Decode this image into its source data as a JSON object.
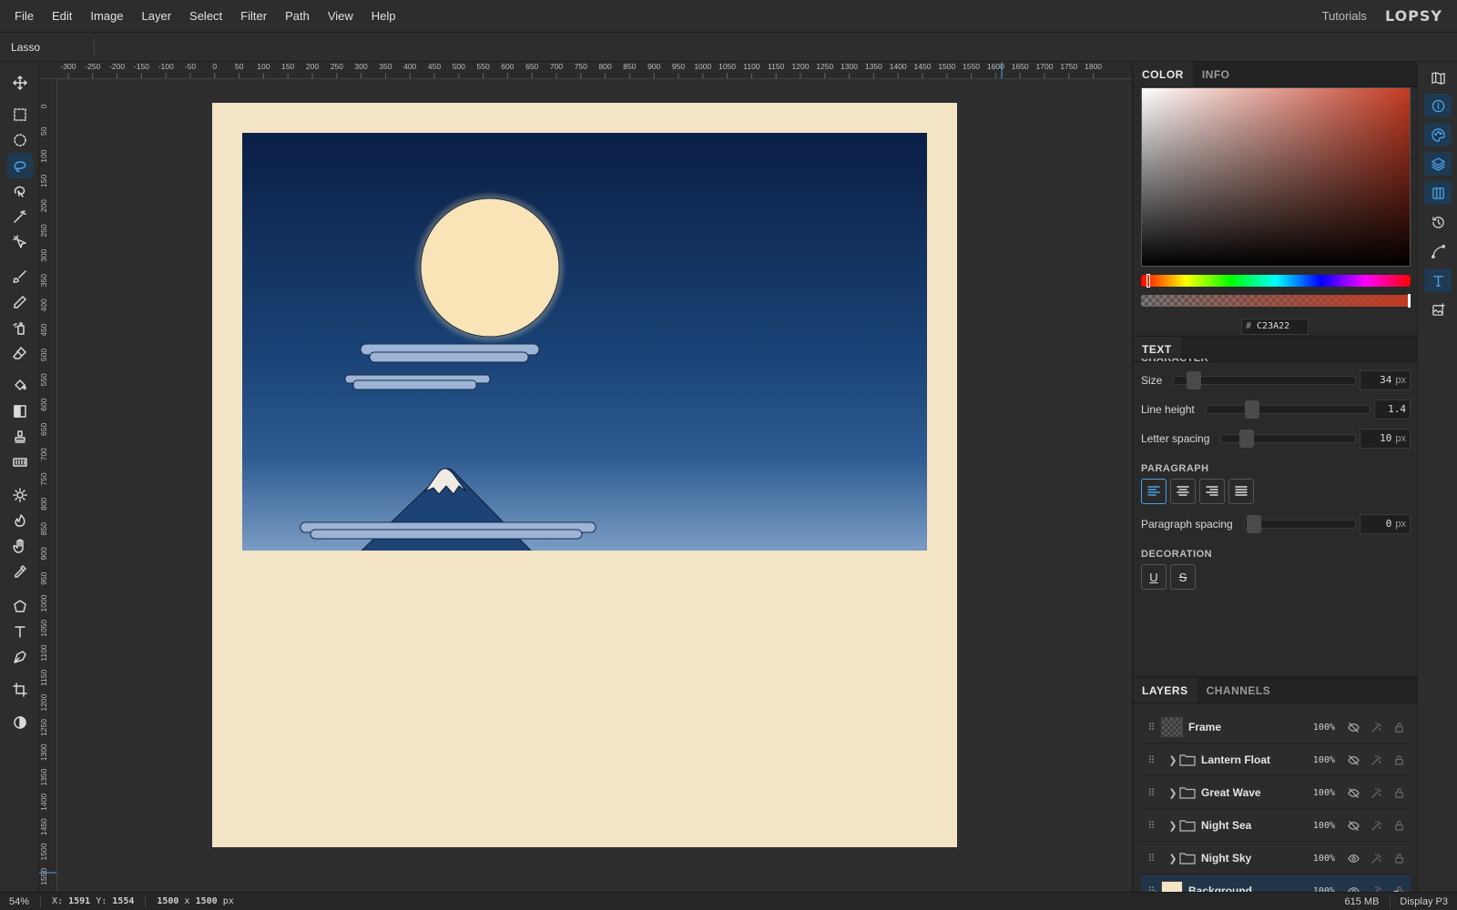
{
  "menu": [
    "File",
    "Edit",
    "Image",
    "Layer",
    "Select",
    "Filter",
    "Path",
    "View",
    "Help"
  ],
  "header": {
    "tutorials": "Tutorials",
    "logo": "LOPSY"
  },
  "options_bar": {
    "tool_name": "Lasso"
  },
  "tools": [
    "move-icon",
    "marquee-icon",
    "ellipse-select-icon",
    "lasso-icon",
    "object-select-icon",
    "magic-wand-icon",
    "quick-select-icon",
    "brush-icon",
    "pencil-icon",
    "spray-icon",
    "eraser-icon",
    "bucket-icon",
    "gradient-icon",
    "stamp-icon",
    "pattern-icon",
    "dodge-icon",
    "burn-icon",
    "hand-icon",
    "eyedropper-icon",
    "polygon-icon",
    "text-icon",
    "pen-icon",
    "crop-icon",
    "contrast-icon"
  ],
  "ruler": {
    "h_labels": [
      "-300",
      "-250",
      "-200",
      "-150",
      "-100",
      "-50",
      "0",
      "50",
      "100",
      "150",
      "200",
      "250",
      "300",
      "350",
      "400",
      "450",
      "500",
      "550",
      "600",
      "650",
      "700",
      "750",
      "800",
      "850",
      "900",
      "950",
      "1000",
      "1050",
      "1100",
      "1150",
      "1200",
      "1250",
      "1300",
      "1350",
      "1400",
      "1450",
      "1500",
      "1550",
      "1600",
      "1650",
      "1700",
      "1750",
      "1800"
    ],
    "v_labels": [
      "0",
      "50",
      "100",
      "150",
      "200",
      "250",
      "300",
      "350",
      "400",
      "450",
      "500",
      "550",
      "600",
      "650",
      "700",
      "750",
      "800",
      "850",
      "900",
      "950",
      "1000",
      "1050",
      "1100",
      "1150",
      "1200",
      "1250",
      "1300",
      "1350",
      "1400",
      "1450",
      "1500",
      "1550"
    ]
  },
  "color_panel": {
    "tabs": [
      "COLOR",
      "INFO"
    ],
    "hex_prefix": "#",
    "hex": "C23A22",
    "current_color": "#c23a22"
  },
  "text_panel": {
    "title": "TEXT",
    "section_character": "CHARACTER",
    "size": {
      "label": "Size",
      "value": "34",
      "unit": "px"
    },
    "line_height": {
      "label": "Line height",
      "value": "1.4"
    },
    "letter_spacing": {
      "label": "Letter spacing",
      "value": "10",
      "unit": "px"
    },
    "section_paragraph": "PARAGRAPH",
    "paragraph_spacing": {
      "label": "Paragraph spacing",
      "value": "0",
      "unit": "px"
    },
    "section_decoration": "DECORATION",
    "decoration_underline": "U",
    "decoration_strike": "S"
  },
  "layers_panel": {
    "tabs": [
      "LAYERS",
      "CHANNELS"
    ],
    "layers": [
      {
        "name": "Frame",
        "opacity": "100%",
        "visible": false,
        "group": false
      },
      {
        "name": "Lantern Float",
        "opacity": "100%",
        "visible": false,
        "group": true
      },
      {
        "name": "Great Wave",
        "opacity": "100%",
        "visible": false,
        "group": true
      },
      {
        "name": "Night Sea",
        "opacity": "100%",
        "visible": false,
        "group": true
      },
      {
        "name": "Night Sky",
        "opacity": "100%",
        "visible": true,
        "group": true
      },
      {
        "name": "Background",
        "opacity": "100%",
        "visible": true,
        "group": false,
        "selected": true
      }
    ]
  },
  "status": {
    "zoom": "54%",
    "x_label": "X:",
    "x": "1591",
    "y_label": "Y:",
    "y": "1554",
    "doc_w": "1500",
    "doc_x": "x",
    "doc_h": "1500",
    "doc_unit": "px",
    "memory": "615 MB",
    "display": "Display P3"
  },
  "canvas": {
    "paper_color": "#f2e4c4",
    "sky_top": "#0a1f45",
    "sky_bottom": "#7a9cc4",
    "moon_color": "#f8e4b6",
    "cloud_color": "#9cb4d6",
    "mountain_color": "#1d4375"
  }
}
